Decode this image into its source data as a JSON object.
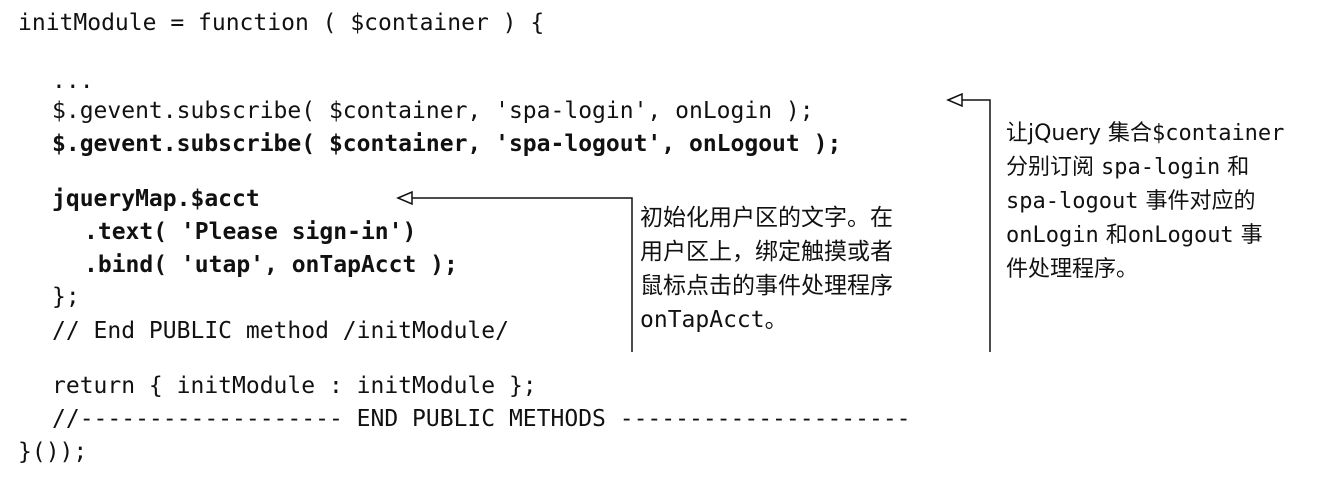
{
  "code_lines": [
    "initModule = function ( $container ) {",
    "...",
    "$.gevent.subscribe( $container, 'spa-login', onLogin );",
    "$.gevent.subscribe( $container, 'spa-logout', onLogout );",
    "jqueryMap.$acct",
    ".text( 'Please sign-in')",
    ".bind( 'utap', onTapAcct );",
    "};",
    "// End PUBLIC method /initModule/",
    "return { initModule : initModule };",
    "//------------------- END PUBLIC METHODS ---------------------",
    "}());"
  ],
  "annotation_middle": {
    "line1": "初始化用户区的文字。在",
    "line2": "用户区上，绑定触摸或者",
    "line3": "鼠标点击的事件处理程序",
    "line4": "onTapAcct。"
  },
  "annotation_right": {
    "line1_a": "让jQuery 集合",
    "line1_b": "$container",
    "line2_a": "分别订阅 ",
    "line2_b": "spa-login",
    "line2_c": " 和",
    "line3_a": "spa-logout",
    "line3_b": " 事件对应的",
    "line4_a": "onLogin",
    "line4_b": " 和",
    "line4_c": "onLogout",
    "line4_d": " 事",
    "line5": "件处理程序。"
  }
}
